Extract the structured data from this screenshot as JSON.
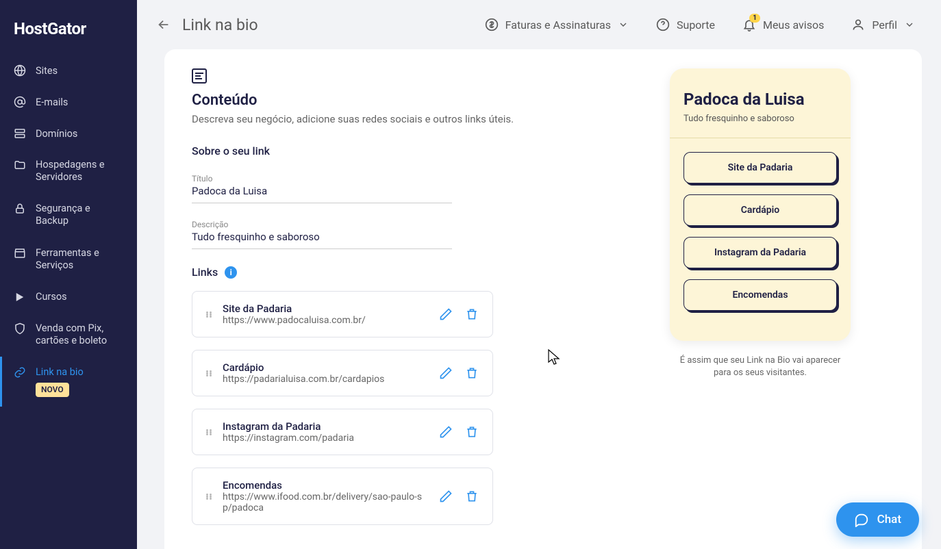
{
  "brand": "HostGator",
  "sidebar": {
    "items": [
      {
        "label": "Sites"
      },
      {
        "label": "E-mails"
      },
      {
        "label": "Domínios"
      },
      {
        "label": "Hospedagens e Servidores"
      },
      {
        "label": "Segurança e Backup"
      },
      {
        "label": "Ferramentas e Serviços"
      },
      {
        "label": "Cursos"
      },
      {
        "label": "Venda com Pix, cartões e boleto"
      },
      {
        "label": "Link na bio",
        "badge": "NOVO"
      }
    ]
  },
  "topbar": {
    "page_title": "Link na bio",
    "billing": "Faturas e Assinaturas",
    "support": "Suporte",
    "notices": "Meus avisos",
    "notices_badge": "1",
    "profile": "Perfil"
  },
  "content": {
    "heading": "Conteúdo",
    "desc": "Descreva seu negócio, adicione suas redes sociais e outros links úteis.",
    "about_heading": "Sobre o seu link",
    "title_label": "Título",
    "title_value": "Padoca da Luisa",
    "desc_label": "Descrição",
    "desc_value": "Tudo fresquinho e saboroso",
    "links_heading": "Links",
    "links": [
      {
        "title": "Site da Padaria",
        "url": "https://www.padocaluisa.com.br/"
      },
      {
        "title": "Cardápio",
        "url": "https://padarialuisa.com.br/cardapios"
      },
      {
        "title": "Instagram da Padaria",
        "url": "https://instagram.com/padaria"
      },
      {
        "title": "Encomendas",
        "url": "https://www.ifood.com.br/delivery/sao-paulo-sp/padoca"
      }
    ]
  },
  "preview": {
    "title": "Padoca da Luisa",
    "subtitle": "Tudo fresquinho e saboroso",
    "buttons": [
      "Site da Padaria",
      "Cardápio",
      "Instagram da Padaria",
      "Encomendas"
    ],
    "caption": "É assim que seu Link na Bio vai aparecer para os seus visitantes."
  },
  "chat": {
    "label": "Chat"
  }
}
